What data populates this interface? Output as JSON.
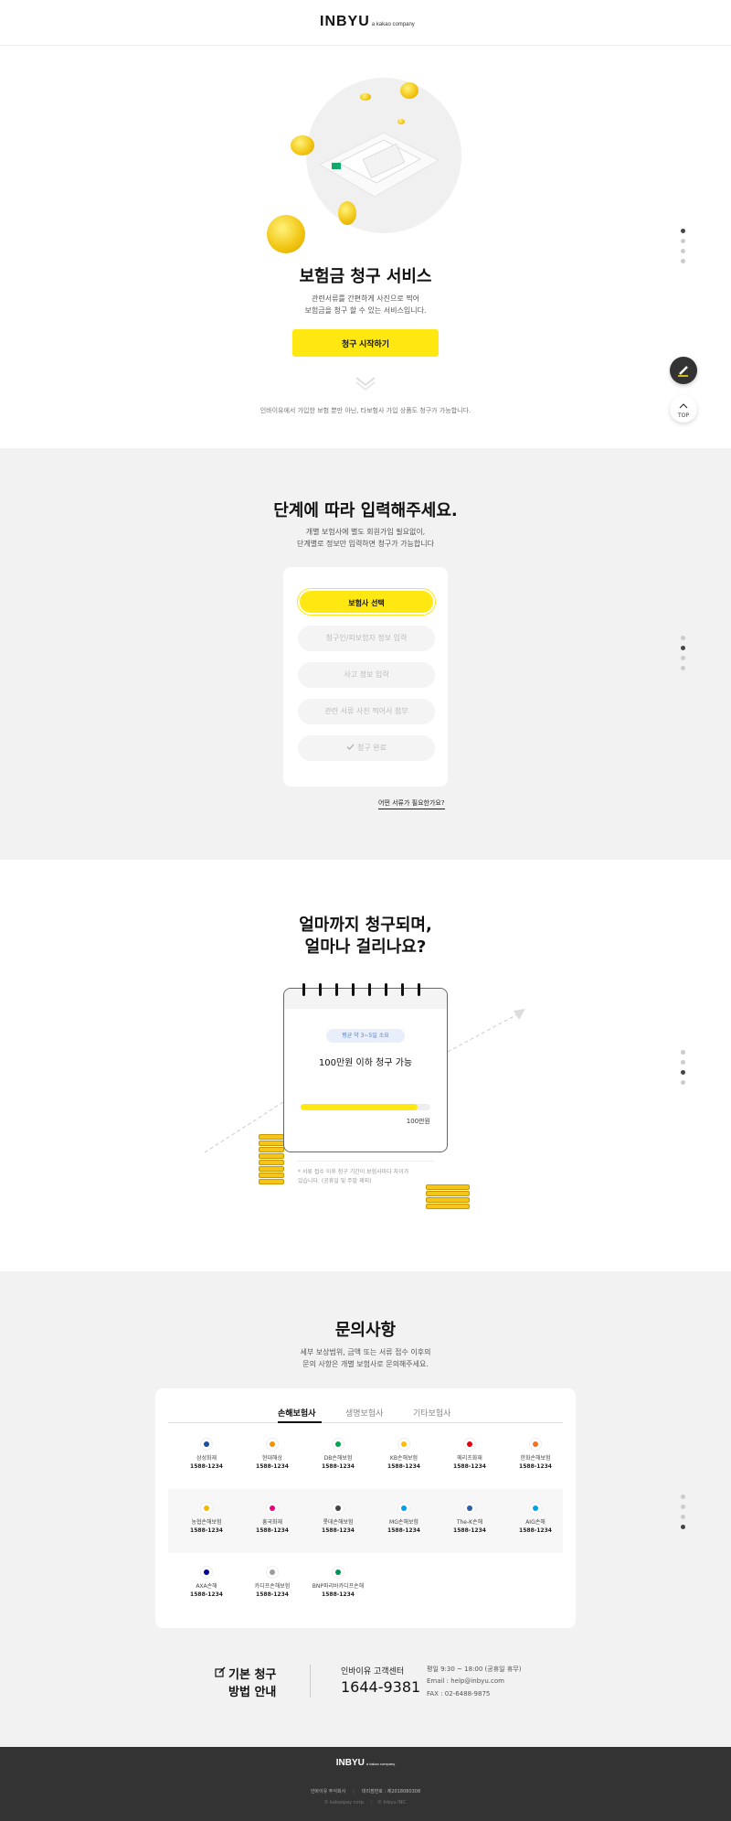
{
  "header": {
    "logo": "INBYU",
    "logo_sub": "a kakao company"
  },
  "hero": {
    "title": "보험금 청구 서비스",
    "desc_line1": "관련서류를 간편하게 사진으로 찍어",
    "desc_line2": "보험금을 청구 할 수 있는 서비스입니다.",
    "cta": "청구 시작하기",
    "note": "인바이유에서 가입한 보험 뿐만 아닌, 타보험사 가입 상품도 청구가 가능합니다."
  },
  "floating": {
    "top_label": "TOP"
  },
  "steps": {
    "title": "단계에 따라 입력해주세요.",
    "desc_line1": "개별 보험사에 별도 회원가입 필요없이,",
    "desc_line2": "단계별로 정보만 입력하면 청구가 가능합니다",
    "items": [
      "보험사 선택",
      "청구인/피보험자 정보 입력",
      "사고 정보 입력",
      "관련 서류 사진 찍어서 첨부",
      "청구 완료"
    ],
    "link": "어떤 서류가 필요한가요?"
  },
  "amount": {
    "title_line1": "얼마까지 청구되며,",
    "title_line2": "얼마나 걸리나요?",
    "badge": "평균 약 3~5일 소요",
    "headline": "100만원 이하 청구 가능",
    "progress": 0.9,
    "progress_label": "100만원",
    "note_line1": "* 서류 접수 이후 청구 기간이 보험사마다 차이가",
    "note_line2": "있습니다. (공휴일 및 주말 제외)"
  },
  "inquiry": {
    "title": "문의사항",
    "desc_line1": "세부 보상범위, 금액 또는 서류 접수 이후의",
    "desc_line2": "문의 사항은 개별 보험사로 문의해주세요.",
    "tabs": [
      "손해보험사",
      "생명보험사",
      "기타보험사"
    ],
    "companies": [
      {
        "name": "삼성화재",
        "phone": "1588-1234",
        "color": "#1a4ea1"
      },
      {
        "name": "현대해상",
        "phone": "1588-1234",
        "color": "#f39200"
      },
      {
        "name": "DB손해보험",
        "phone": "1588-1234",
        "color": "#00a651"
      },
      {
        "name": "KB손해보험",
        "phone": "1588-1234",
        "color": "#ffbc00"
      },
      {
        "name": "메리츠화재",
        "phone": "1588-1234",
        "color": "#e60012"
      },
      {
        "name": "한화손해보험",
        "phone": "1588-1234",
        "color": "#f37321"
      },
      {
        "name": "농협손해보험",
        "phone": "1588-1234",
        "color": "#f5b700"
      },
      {
        "name": "흥국화재",
        "phone": "1588-1234",
        "color": "#e4007f"
      },
      {
        "name": "롯데손해보험",
        "phone": "1588-1234",
        "color": "#444444"
      },
      {
        "name": "MG손해보험",
        "phone": "1588-1234",
        "color": "#00a0e9"
      },
      {
        "name": "The-K손해",
        "phone": "1588-1234",
        "color": "#2b5fa8"
      },
      {
        "name": "AIG손해",
        "phone": "1588-1234",
        "color": "#00a4e4"
      },
      {
        "name": "AXA손해",
        "phone": "1588-1234",
        "color": "#00008f"
      },
      {
        "name": "카디프손해보험",
        "phone": "1588-1234",
        "color": "#9b9b9b"
      },
      {
        "name": "BNP파리바카디프손해",
        "phone": "1588-1234",
        "color": "#00915a"
      }
    ]
  },
  "contact": {
    "guide_line1": "기본 청구",
    "guide_line2": "방법 안내",
    "center_label": "인바이유 고객센터",
    "phone": "1644-9381",
    "hours": "평일 9:30 ~ 18:00 (공휴일 휴무)",
    "email": "Email : help@inbyu.com",
    "fax": "FAX : 02-6488-9875"
  },
  "footer": {
    "logo": "INBYU",
    "logo_sub": "a kakao company",
    "company": "인바이유 주식회사",
    "license": "대리점번호 : 제2018080308",
    "copy1": "© kakaopay corp.",
    "copy2": "© Inbyu INC."
  }
}
